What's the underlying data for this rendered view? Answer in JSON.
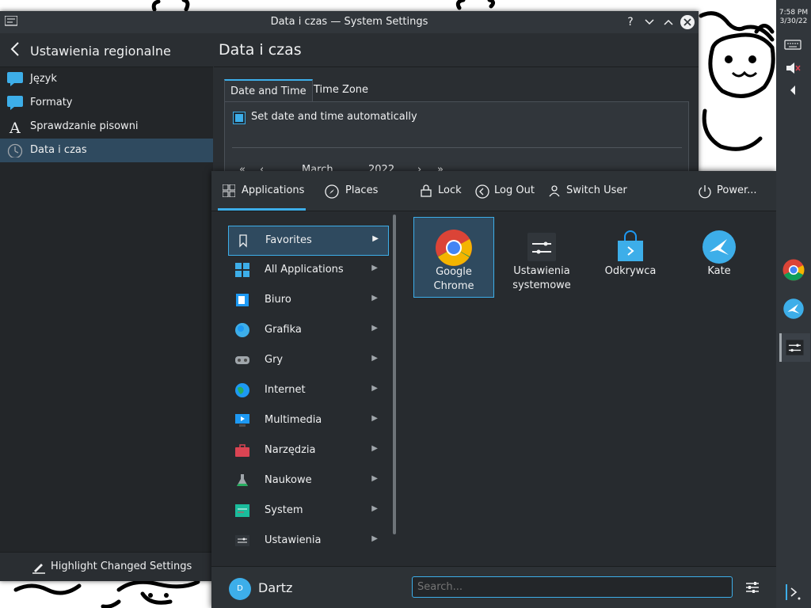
{
  "window": {
    "title": "Data i czas — System Settings",
    "help": "?",
    "minimize": "﹀",
    "maximize": "︿",
    "close": "✕"
  },
  "sidebar": {
    "header": "Ustawienia regionalne",
    "items": [
      {
        "label": "Język",
        "icon": "chat-bubble-icon"
      },
      {
        "label": "Formaty",
        "icon": "chat-bubble-icon"
      },
      {
        "label": "Sprawdzanie pisowni",
        "icon": "letter-a-icon"
      },
      {
        "label": "Data i czas",
        "icon": "clock-icon",
        "active": true
      }
    ],
    "footer": "Highlight Changed Settings"
  },
  "main": {
    "title": "Data i czas",
    "tabs": [
      "Date and Time",
      "Time Zone"
    ],
    "checkbox_label": "Set date and time automatically",
    "calendar": {
      "month": "March",
      "year": "2022"
    }
  },
  "launcher": {
    "header": {
      "applications": "Applications",
      "places": "Places",
      "lock": "Lock",
      "logout": "Log Out",
      "switch_user": "Switch User",
      "power": "Power..."
    },
    "categories": [
      "Favorites",
      "All Applications",
      "Biuro",
      "Grafika",
      "Gry",
      "Internet",
      "Multimedia",
      "Narzędzia",
      "Naukowe",
      "System",
      "Ustawienia"
    ],
    "favorites": [
      {
        "line1": "Google",
        "line2": "Chrome"
      },
      {
        "line1": "Ustawienia",
        "line2": "systemowe"
      },
      {
        "line1": "Odkrywca",
        "line2": ""
      },
      {
        "line1": "Kate",
        "line2": ""
      }
    ],
    "user": {
      "initial": "D",
      "name": "Dartz"
    },
    "search_placeholder": "Search..."
  },
  "panel": {
    "time": "7:58 PM",
    "date": "3/30/22"
  },
  "colors": {
    "accent": "#3daee9",
    "window_bg": "#2a2e32",
    "sidebar_bg": "#232629",
    "selection": "#2f4a5f"
  }
}
